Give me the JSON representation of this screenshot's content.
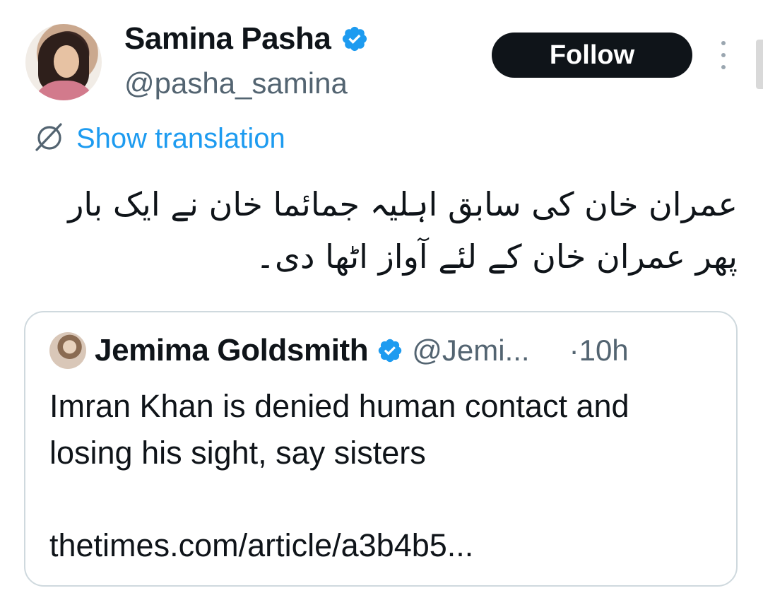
{
  "author": {
    "display_name": "Samina Pasha",
    "handle": "@pasha_samina",
    "verified": true
  },
  "actions": {
    "follow_label": "Follow",
    "more_icon": "more-vertical-icon"
  },
  "translation": {
    "label": "Show translation",
    "icon": "translate-icon"
  },
  "tweet": {
    "text": "عمران خان کی سابق اہلیہ جمائما خان نے ایک بار پھر عمران خان کے لئے آواز اٹھا دی۔"
  },
  "quoted": {
    "display_name": "Jemima Goldsmith",
    "handle": "@Jemi...",
    "separator": "·",
    "time": "10h",
    "text": "Imran Khan is denied human contact and losing his sight, say sisters",
    "link": "thetimes.com/article/a3b4b5..."
  },
  "colors": {
    "link_blue": "#1d9bf0",
    "verified_blue": "#1d9bf0",
    "muted_gray": "#536471",
    "button_black": "#0f1419",
    "border": "#cfd9de"
  }
}
